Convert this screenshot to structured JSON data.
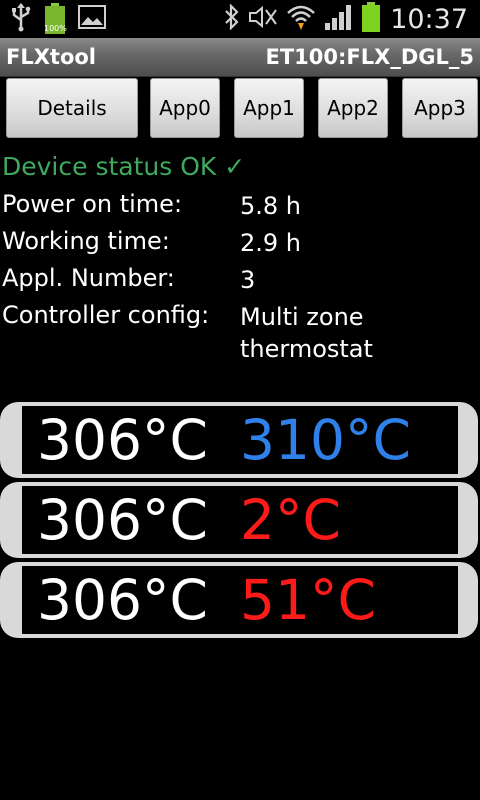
{
  "statusbar": {
    "time": "10:37",
    "battery_label": "100%",
    "icons": [
      "usb-icon",
      "battery-full-icon",
      "image-icon",
      "bluetooth-icon",
      "mute-icon",
      "wifi-icon",
      "signal-icon",
      "battery-icon"
    ]
  },
  "titlebar": {
    "app_name": "FLXtool",
    "device": "ET100:FLX_DGL_5"
  },
  "buttons": [
    {
      "label": "Details"
    },
    {
      "label": "App0"
    },
    {
      "label": "App1"
    },
    {
      "label": "App2"
    },
    {
      "label": "App3"
    }
  ],
  "device_status": "Device status OK ✓",
  "info": [
    {
      "label": "Power on time:",
      "value": "5.8 h"
    },
    {
      "label": "Working time:",
      "value": "2.9 h"
    },
    {
      "label": "Appl. Number:",
      "value": "3"
    },
    {
      "label": "Controller config:",
      "value": "Multi zone thermostat"
    }
  ],
  "zones": [
    {
      "actual": "306°C",
      "setpoint": "310°C",
      "setpoint_color": "#2f80e8"
    },
    {
      "actual": "306°C",
      "setpoint": "2°C",
      "setpoint_color": "#ff1a1a"
    },
    {
      "actual": "306°C",
      "setpoint": "51°C",
      "setpoint_color": "#ff1a1a"
    }
  ],
  "colors": {
    "status_ok": "#3fa95f",
    "battery": "#7ed321"
  }
}
